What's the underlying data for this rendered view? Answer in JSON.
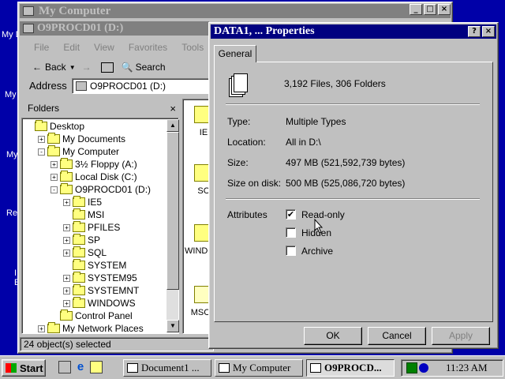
{
  "desktop": {
    "labels": [
      "My D",
      "My",
      "My",
      "Re",
      "I",
      "E"
    ]
  },
  "explorer": {
    "title": "My Computer",
    "subtitle": "O9PROCD01 (D:)",
    "menu": [
      "File",
      "Edit",
      "View",
      "Favorites",
      "Tools"
    ],
    "toolbar": {
      "back": "Back",
      "search": "Search"
    },
    "address_label": "Address",
    "address_value": "O9PROCD01 (D:)",
    "folders_title": "Folders",
    "tree": [
      {
        "label": "Desktop",
        "level": 0,
        "pm": ""
      },
      {
        "label": "My Documents",
        "level": 1,
        "pm": "+"
      },
      {
        "label": "My Computer",
        "level": 1,
        "pm": "-"
      },
      {
        "label": "3½ Floppy (A:)",
        "level": 2,
        "pm": "+"
      },
      {
        "label": "Local Disk (C:)",
        "level": 2,
        "pm": "+"
      },
      {
        "label": "O9PROCD01 (D:)",
        "level": 2,
        "pm": "-"
      },
      {
        "label": "IE5",
        "level": 3,
        "pm": "+"
      },
      {
        "label": "MSI",
        "level": 3,
        "pm": ""
      },
      {
        "label": "PFILES",
        "level": 3,
        "pm": "+"
      },
      {
        "label": "SP",
        "level": 3,
        "pm": "+"
      },
      {
        "label": "SQL",
        "level": 3,
        "pm": "+"
      },
      {
        "label": "SYSTEM",
        "level": 3,
        "pm": ""
      },
      {
        "label": "SYSTEM95",
        "level": 3,
        "pm": "+"
      },
      {
        "label": "SYSTEMNT",
        "level": 3,
        "pm": "+"
      },
      {
        "label": "WINDOWS",
        "level": 3,
        "pm": "+"
      },
      {
        "label": "Control Panel",
        "level": 2,
        "pm": ""
      },
      {
        "label": "My Network Places",
        "level": 1,
        "pm": "+"
      }
    ],
    "file_labels": [
      "IE",
      "SC",
      "WINDO",
      "MSC"
    ],
    "status": "24 object(s) selected"
  },
  "dialog": {
    "title": "DATA1, ... Properties",
    "tab": "General",
    "summary": "3,192 Files, 306 Folders",
    "rows": [
      {
        "label": "Type:",
        "value": "Multiple Types"
      },
      {
        "label": "Location:",
        "value": "All in D:\\"
      },
      {
        "label": "Size:",
        "value": "497 MB (521,592,739 bytes)"
      },
      {
        "label": "Size on disk:",
        "value": "500 MB (525,086,720 bytes)"
      }
    ],
    "attributes_label": "Attributes",
    "checkboxes": [
      {
        "label": "Read-only",
        "checked": "✔"
      },
      {
        "label": "Hidden",
        "checked": ""
      },
      {
        "label": "Archive",
        "checked": ""
      }
    ],
    "buttons": {
      "ok": "OK",
      "cancel": "Cancel",
      "apply": "Apply"
    }
  },
  "taskbar": {
    "start": "Start",
    "tasks": [
      "Document1 ...",
      "My Computer",
      "O9PROCD..."
    ],
    "clock": "11:23 AM"
  }
}
